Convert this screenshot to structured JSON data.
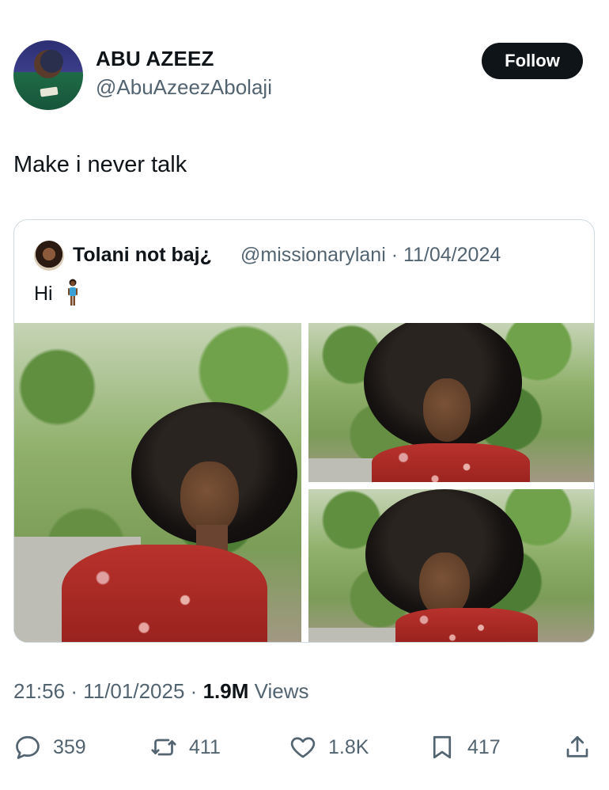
{
  "author": {
    "display_name": "ABU AZEEZ",
    "handle": "@AbuAzeezAbolaji",
    "follow_label": "Follow"
  },
  "tweet": {
    "text": "Make i never talk"
  },
  "quoted": {
    "name": "Tolani not baj¿",
    "handle_date": "@missionarylani · 11/04/2024",
    "text": "Hi"
  },
  "meta": {
    "time": "21:56",
    "date": "11/01/2025",
    "views_count": "1.9M",
    "views_label": "Views"
  },
  "actions": {
    "replies": "359",
    "reposts": "411",
    "likes": "1.8K",
    "bookmarks": "417"
  },
  "colors": {
    "text": "#0f1419",
    "secondary": "#536471",
    "border": "#cfd9de",
    "button": "#0f1419"
  }
}
